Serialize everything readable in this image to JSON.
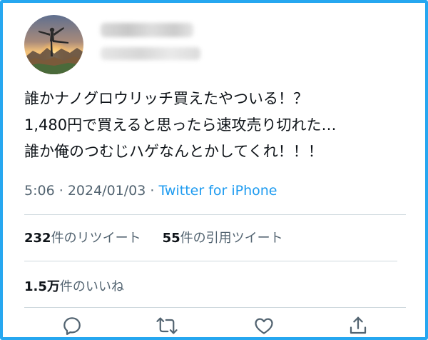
{
  "tweet": {
    "lines": [
      "誰かナノグロウリッチ買えたやついる！？",
      "1,480円で買えると思ったら速攻売り切れた…",
      "誰か俺のつむじハゲなんとかしてくれ！！！"
    ],
    "time": "5:06",
    "date": "2024/01/03",
    "separator": "·",
    "source": "Twitter for iPhone"
  },
  "stats": {
    "retweets_count": "232",
    "retweets_label": "件のリツイート",
    "quotes_count": "55",
    "quotes_label": "件の引用ツイート",
    "likes_count": "1.5万",
    "likes_label": "件のいいね"
  },
  "actions": [
    {
      "icon": "reply-icon"
    },
    {
      "icon": "retweet-icon"
    },
    {
      "icon": "like-icon"
    },
    {
      "icon": "share-icon"
    }
  ],
  "colors": {
    "frame_border": "#26a7f0",
    "link": "#1d9bf0",
    "muted": "#536471",
    "divider": "#cfd9de"
  }
}
